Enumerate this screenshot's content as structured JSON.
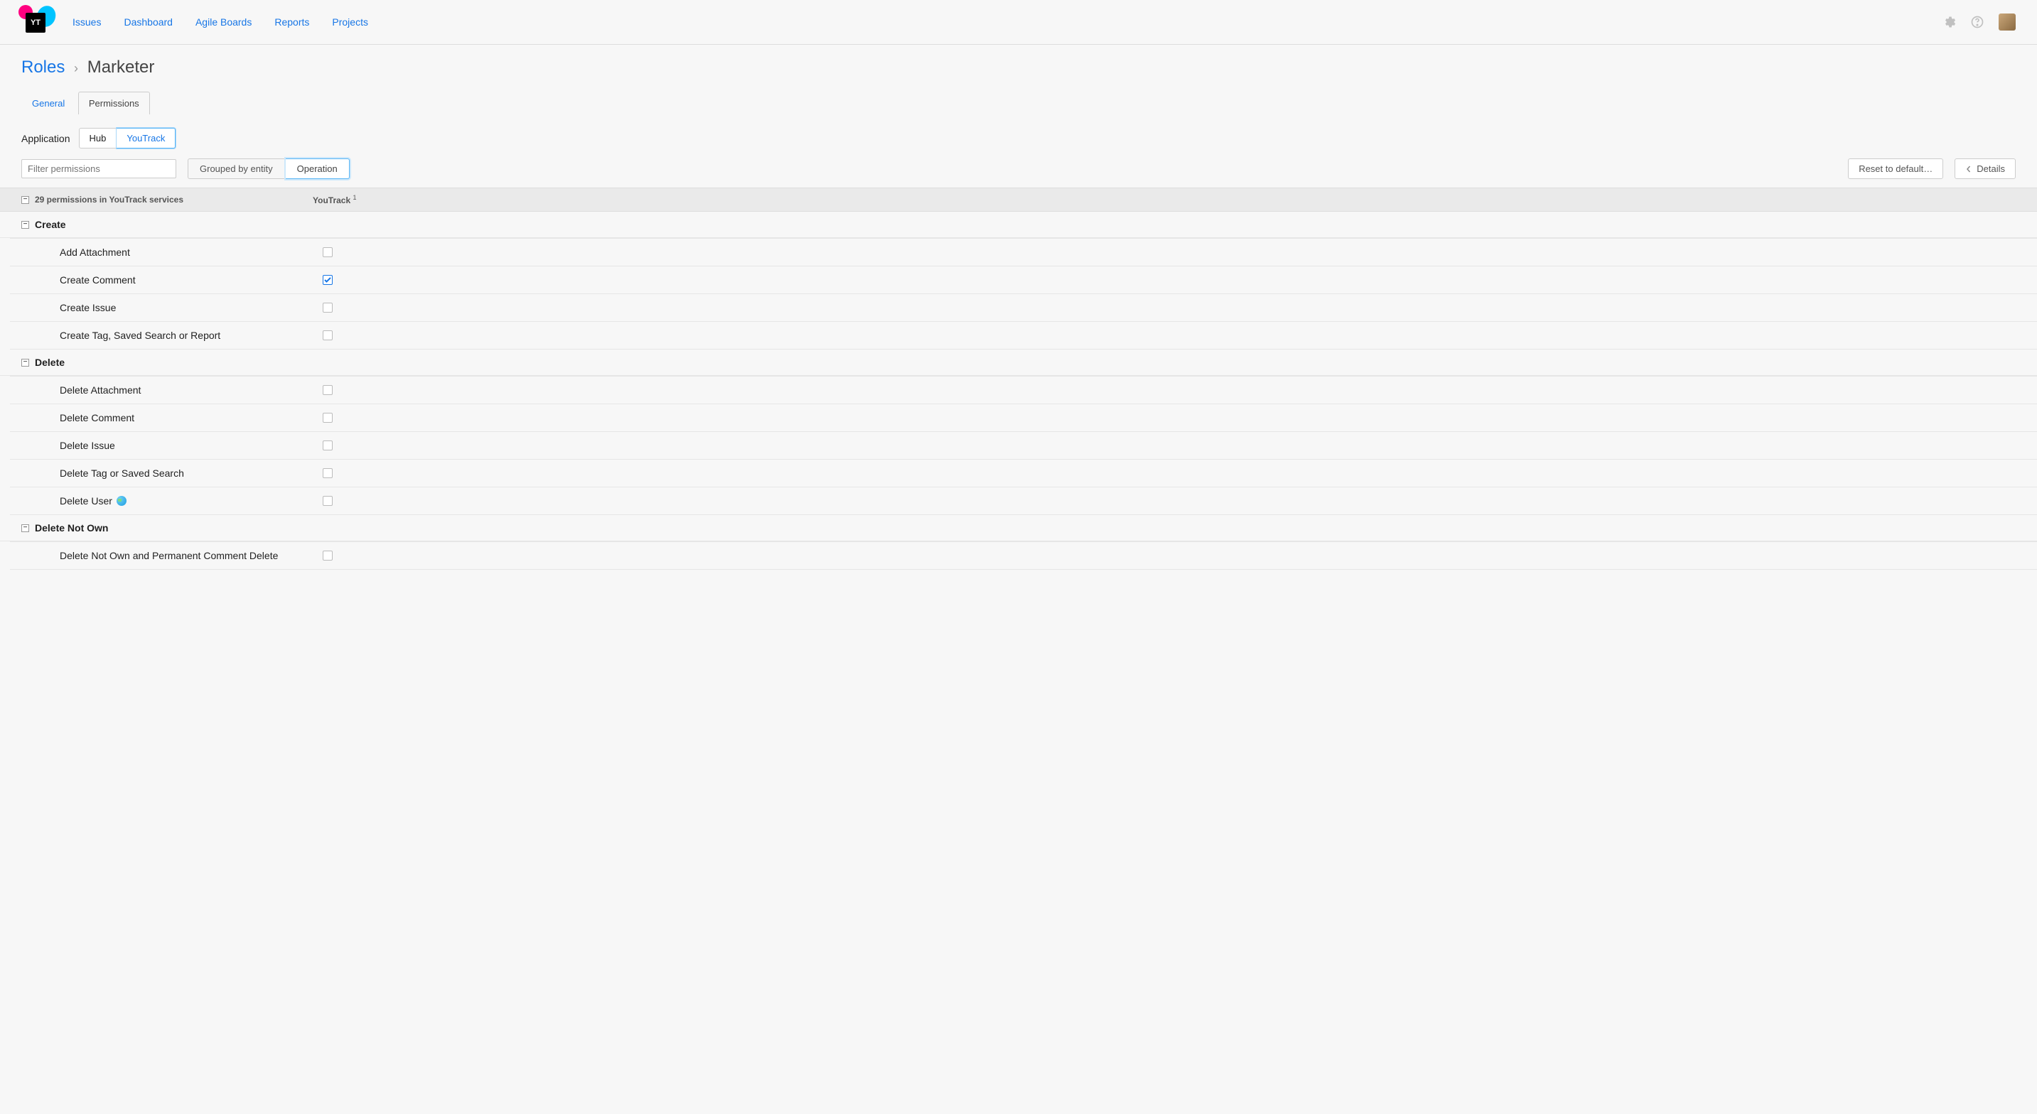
{
  "nav": {
    "items": [
      "Issues",
      "Dashboard",
      "Agile Boards",
      "Reports",
      "Projects"
    ]
  },
  "logo_text": "YT",
  "breadcrumb": {
    "root": "Roles",
    "sep": "›",
    "current": "Marketer"
  },
  "tabs": {
    "general": "General",
    "permissions": "Permissions"
  },
  "application_label": "Application",
  "app_toggle": {
    "hub": "Hub",
    "youtrack": "YouTrack"
  },
  "filter_placeholder": "Filter permissions",
  "grouping": {
    "entity": "Grouped by entity",
    "operation": "Operation"
  },
  "reset_label": "Reset to default…",
  "details_label": "Details",
  "table_header": {
    "count": "29 permissions in YouTrack services",
    "youtrack": "YouTrack",
    "sup": "1"
  },
  "groups": [
    {
      "name": "Create",
      "permissions": [
        {
          "label": "Add Attachment",
          "checked": false,
          "global": false
        },
        {
          "label": "Create Comment",
          "checked": true,
          "global": false
        },
        {
          "label": "Create Issue",
          "checked": false,
          "global": false
        },
        {
          "label": "Create Tag, Saved Search or Report",
          "checked": false,
          "global": false
        }
      ]
    },
    {
      "name": "Delete",
      "permissions": [
        {
          "label": "Delete Attachment",
          "checked": false,
          "global": false
        },
        {
          "label": "Delete Comment",
          "checked": false,
          "global": false
        },
        {
          "label": "Delete Issue",
          "checked": false,
          "global": false
        },
        {
          "label": "Delete Tag or Saved Search",
          "checked": false,
          "global": false
        },
        {
          "label": "Delete User",
          "checked": false,
          "global": true
        }
      ]
    },
    {
      "name": "Delete Not Own",
      "permissions": [
        {
          "label": "Delete Not Own and Permanent Comment Delete",
          "checked": false,
          "global": false
        }
      ]
    }
  ]
}
